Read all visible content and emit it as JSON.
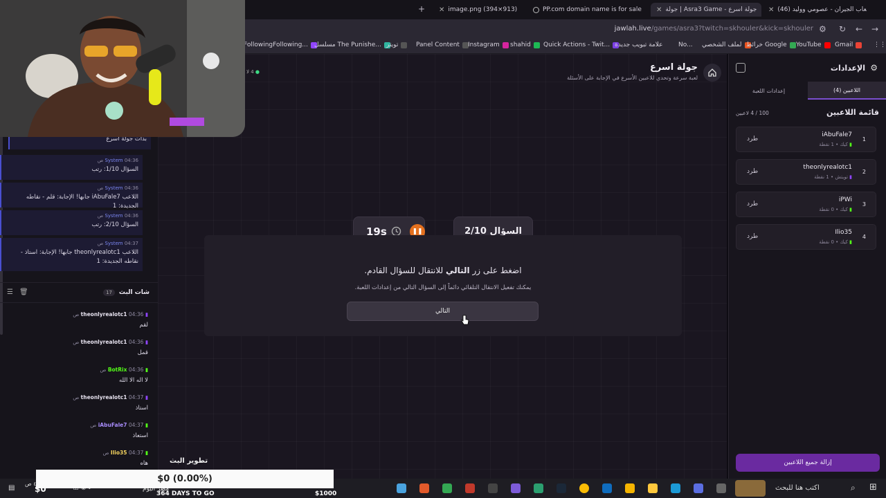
{
  "browser": {
    "tabs": [
      {
        "label": "image.png (394×913)"
      },
      {
        "label": "PP.com domain name is for sale"
      },
      {
        "label": "جولة | Asra3 Game - جولة اسرع"
      },
      {
        "label": "(46) ألعاب الجيران - عصومي ووليد"
      }
    ],
    "url_host": "jawlah.live",
    "url_path": "/games/asra3?twitch=skhouler&kick=skhouler",
    "bookmarks": [
      "FollowingFollowing...",
      "مسلسل The Punishe...",
      "تويتر",
      "Panel Content",
      "Instagram",
      "shahid",
      "Quick Actions - Twit...",
      "علامة تبويب جديدة",
      "No...",
      "لملف الشخصي",
      "خرائط Google",
      "YouTube",
      "Gmail"
    ]
  },
  "chat": {
    "first_line": "بدأت جولة اسرع",
    "system_messages": [
      {
        "sender": "System",
        "time": "04:36 ص",
        "text": "السؤال 1/10: رتب"
      },
      {
        "sender": "System",
        "time": "04:36 ص",
        "text": "اللاعب iAbuFale7 جابها! الإجابة: قلم - نقاطه الجديدة: 1"
      },
      {
        "sender": "System",
        "time": "04:36 ص",
        "text": "السؤال 2/10: رتب"
      },
      {
        "sender": "System",
        "time": "04:37 ص",
        "text": "اللاعب theonlyrealotc1 جابها! الإجابة: استاذ - نقاطه الجديدة: 1"
      }
    ],
    "title": "شات البث",
    "count": "17",
    "messages": [
      {
        "user": "theonlyrealotc1",
        "time": "04:36 ص",
        "text": "لقم",
        "color": "#9146ff"
      },
      {
        "user": "theonlyrealotc1",
        "time": "04:36 ص",
        "text": "قمل",
        "color": "#9146ff"
      },
      {
        "user": "BotRix",
        "time": "04:36 ص",
        "text": "لا اله الا الله",
        "color": "#53fc18"
      },
      {
        "user": "theonlyrealotc1",
        "time": "04:37 ص",
        "text": "استاذ",
        "color": "#9146ff"
      },
      {
        "user": "iAbuFale7",
        "time": "04:37 ص",
        "text": "استعاذ",
        "color": "#53fc18"
      },
      {
        "user": "Ilio35",
        "time": "04:37 ص",
        "text": "هاه",
        "color": "#53fc18"
      }
    ]
  },
  "game": {
    "title": "جولة اسرع",
    "subtitle": "لعبة سرعة وتحدي للاعبين الأسرع في الإجابة على الأسئلة",
    "players_online": "4 لا",
    "question_label": "السؤال 2/10",
    "timer": "19s",
    "instruction_pre": "اضغط على زر",
    "instruction_bold": "التالي",
    "instruction_post": "للانتقال للسؤال القادم.",
    "hint": "يمكنك تفعيل الانتقال التلقائي دائماً إلى السؤال التالي من إعدادات اللعبة.",
    "next_label": "التالي"
  },
  "settings": {
    "title": "الإعدادات",
    "tab_players": "اللاعبين (4)",
    "tab_game": "إعدادات اللعبة",
    "list_title": "قائمة اللاعبين",
    "capacity": "100 / 4 لاعبين",
    "kick_label": "طرد",
    "players": [
      {
        "num": "1",
        "name": "iAbuFale7",
        "platform": "كيك",
        "points": "1 نقطة",
        "pcolor": "#53fc18"
      },
      {
        "num": "2",
        "name": "theonlyrealotc1",
        "platform": "تويتش",
        "points": "1 نقطة",
        "pcolor": "#9146ff"
      },
      {
        "num": "3",
        "name": "iPWi",
        "platform": "كيك",
        "points": "0 نقطة",
        "pcolor": "#53fc18"
      },
      {
        "num": "4",
        "name": "Ilio35",
        "platform": "كيك",
        "points": "0 نقطة",
        "pcolor": "#53fc18"
      }
    ],
    "remove_all": "إزالة جميع اللاعبين"
  },
  "overlay": {
    "stream_dev": "تطوير البث",
    "donation": "$0 (0.00%)",
    "goal_left": "$0",
    "days": "364 DAYS TO GO",
    "goal_right": "$1000",
    "weather": "مطر اليوم",
    "search": "اكتب هنا للبحث",
    "clock": "٤:٣٧ ص"
  }
}
